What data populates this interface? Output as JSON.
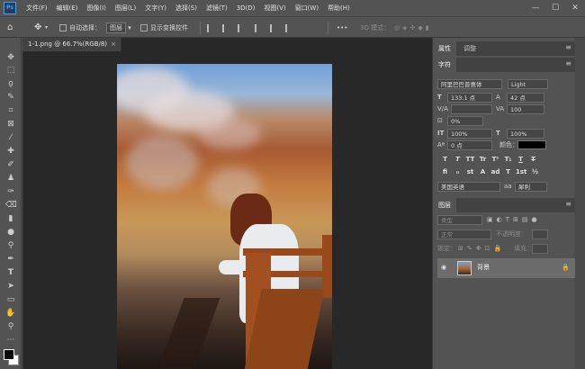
{
  "app": {
    "logo": "Ps"
  },
  "menubar": {
    "items": [
      "文件(F)",
      "编辑(E)",
      "图像(I)",
      "图层(L)",
      "文字(Y)",
      "选择(S)",
      "滤镜(T)",
      "3D(D)",
      "视图(V)",
      "窗口(W)",
      "帮助(H)"
    ],
    "window_controls": {
      "minimize": "—",
      "maximize": "☐",
      "close": "✕"
    }
  },
  "options_bar": {
    "auto_select_label": "自动选择：",
    "auto_select_value": "图层",
    "show_transform_label": "显示变换控件",
    "more": "•••",
    "mode_3d_label": "3D 模式："
  },
  "document": {
    "tab_title": "1-1.png @ 66.7%(RGB/8)",
    "tab_close": "×"
  },
  "panels": {
    "top_tabs": [
      "属性",
      "调整"
    ],
    "character_tab": "字符",
    "font_family": "阿里巴巴普惠体",
    "font_style": "Light",
    "font_size": "133.1 点",
    "leading": "42 点",
    "kerning": "",
    "tracking": "100",
    "tsume": "0%",
    "vscale": "100%",
    "hscale": "100%",
    "baseline": "0 点",
    "color_label": "颜色：",
    "color": "#000000",
    "format_buttons": [
      "T",
      "T",
      "TT",
      "Tr",
      "T¹",
      "T₁",
      "T",
      "T"
    ],
    "ot_buttons": [
      "fi",
      "ℴ",
      "st",
      "A",
      "ad",
      "T",
      "1st",
      "½"
    ],
    "language": "美国英语",
    "antialias_icon": "aa",
    "antialias": "犀利"
  },
  "layers": {
    "tab": "图层",
    "search_placeholder": "类型",
    "blend_mode": "正常",
    "opacity_label": "不透明度：",
    "lock_label": "锁定：",
    "fill_label": "填充：",
    "layer_name": "背景"
  },
  "colors": {
    "accent": "#31a8ff",
    "panel_bg": "#535353",
    "canvas_bg": "#282828"
  }
}
